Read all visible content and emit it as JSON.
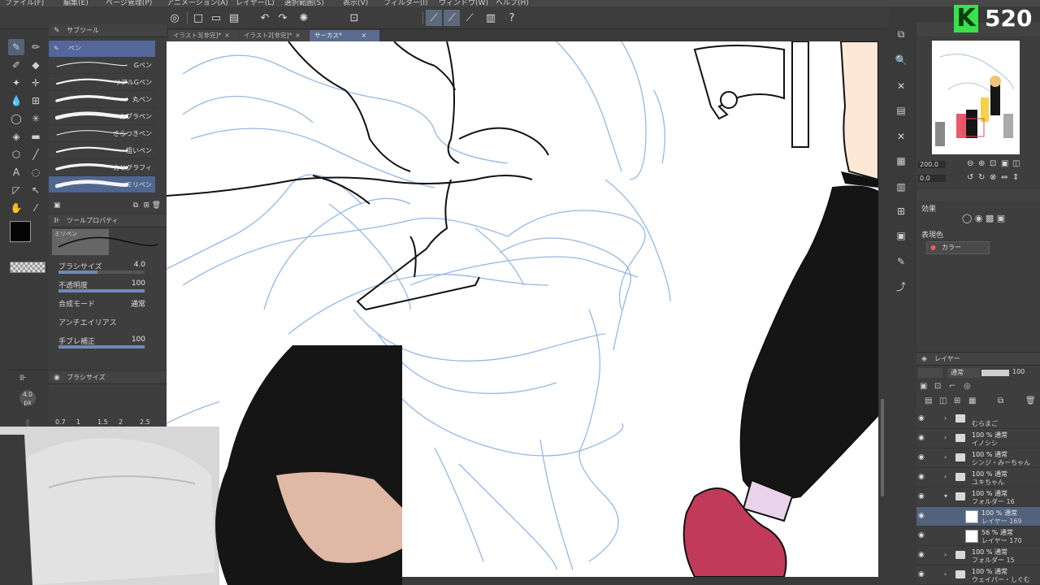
{
  "menu": [
    "ファイル(F)",
    "編集(E)",
    "ページ管理(P)",
    "アニメーション(A)",
    "レイヤー(L)",
    "選択範囲(S)",
    "表示(V)",
    "フィルター(I)",
    "ウィンドウ(W)",
    "ヘルプ(H)"
  ],
  "tabs": [
    {
      "label": "イラスト3[非完]*",
      "active": false
    },
    {
      "label": "イラスト2[非完]*",
      "active": false
    },
    {
      "label": "サーカス*",
      "active": true
    }
  ],
  "subtool": {
    "header": "サブツール",
    "active_group": "ペン",
    "brushes": [
      "Gペン",
      "リアルGペン",
      "丸ペン",
      "カブラペン",
      "さらつきペン",
      "粗いペン",
      "カリグラフィ",
      "ミリペン"
    ],
    "selected_index": 7
  },
  "toolprops": {
    "header": "ツールプロパティ",
    "preview_label": "ミリペン",
    "rows": [
      {
        "label": "ブラシサイズ",
        "value": "4.0",
        "fill": 0.45
      },
      {
        "label": "不透明度",
        "value": "100",
        "fill": 1
      },
      {
        "label": "合成モード",
        "value": "通常"
      },
      {
        "label": "アンチエイリアス",
        "value": ""
      },
      {
        "label": "手ブレ補正",
        "value": "100",
        "fill": 1
      }
    ]
  },
  "brushsize": {
    "header": "ブラシサイズ",
    "values": [
      "0.7",
      "1",
      "1.5",
      "2",
      "2.5"
    ],
    "current": "4.0",
    "unit": "px"
  },
  "navigator": {
    "zoom": "200.0",
    "angle": "0.0",
    "effects_label": "効果",
    "color_label": "表現色",
    "color_mode": "カラー"
  },
  "layers": {
    "blend": "通常",
    "opacity": "100",
    "items": [
      {
        "t1": "",
        "t2": "むらまご",
        "type": "folder",
        "indent": 1,
        "sel": false
      },
      {
        "t1": "100 % 通常",
        "t2": "イノシシ",
        "type": "folder",
        "indent": 1,
        "sel": false
      },
      {
        "t1": "100 % 通常",
        "t2": "シンジ・みーちゃん",
        "type": "folder",
        "indent": 1,
        "sel": false
      },
      {
        "t1": "100 % 通常",
        "t2": "ユキちゃん",
        "type": "folder",
        "indent": 1,
        "sel": false
      },
      {
        "t1": "100 % 通常",
        "t2": "フォルダー 16",
        "type": "folder",
        "indent": 1,
        "sel": false,
        "open": true
      },
      {
        "t1": "100 % 通常",
        "t2": "レイヤー 169",
        "type": "layer",
        "indent": 2,
        "sel": true
      },
      {
        "t1": "56 % 通常",
        "t2": "レイヤー 170",
        "type": "layer",
        "indent": 2,
        "sel": false
      },
      {
        "t1": "100 % 通常",
        "t2": "フォルダー 15",
        "type": "folder",
        "indent": 1,
        "sel": false
      },
      {
        "t1": "100 % 通常",
        "t2": "ウェイパー・しぐむ",
        "type": "folder",
        "indent": 1,
        "sel": false
      }
    ]
  },
  "overlay": {
    "logo_letter": "K",
    "logo_number": "520"
  },
  "colors": {
    "accent": "#5a6d90",
    "logo_green": "#38e24a",
    "sketch_blue": "#8fb4e6"
  }
}
